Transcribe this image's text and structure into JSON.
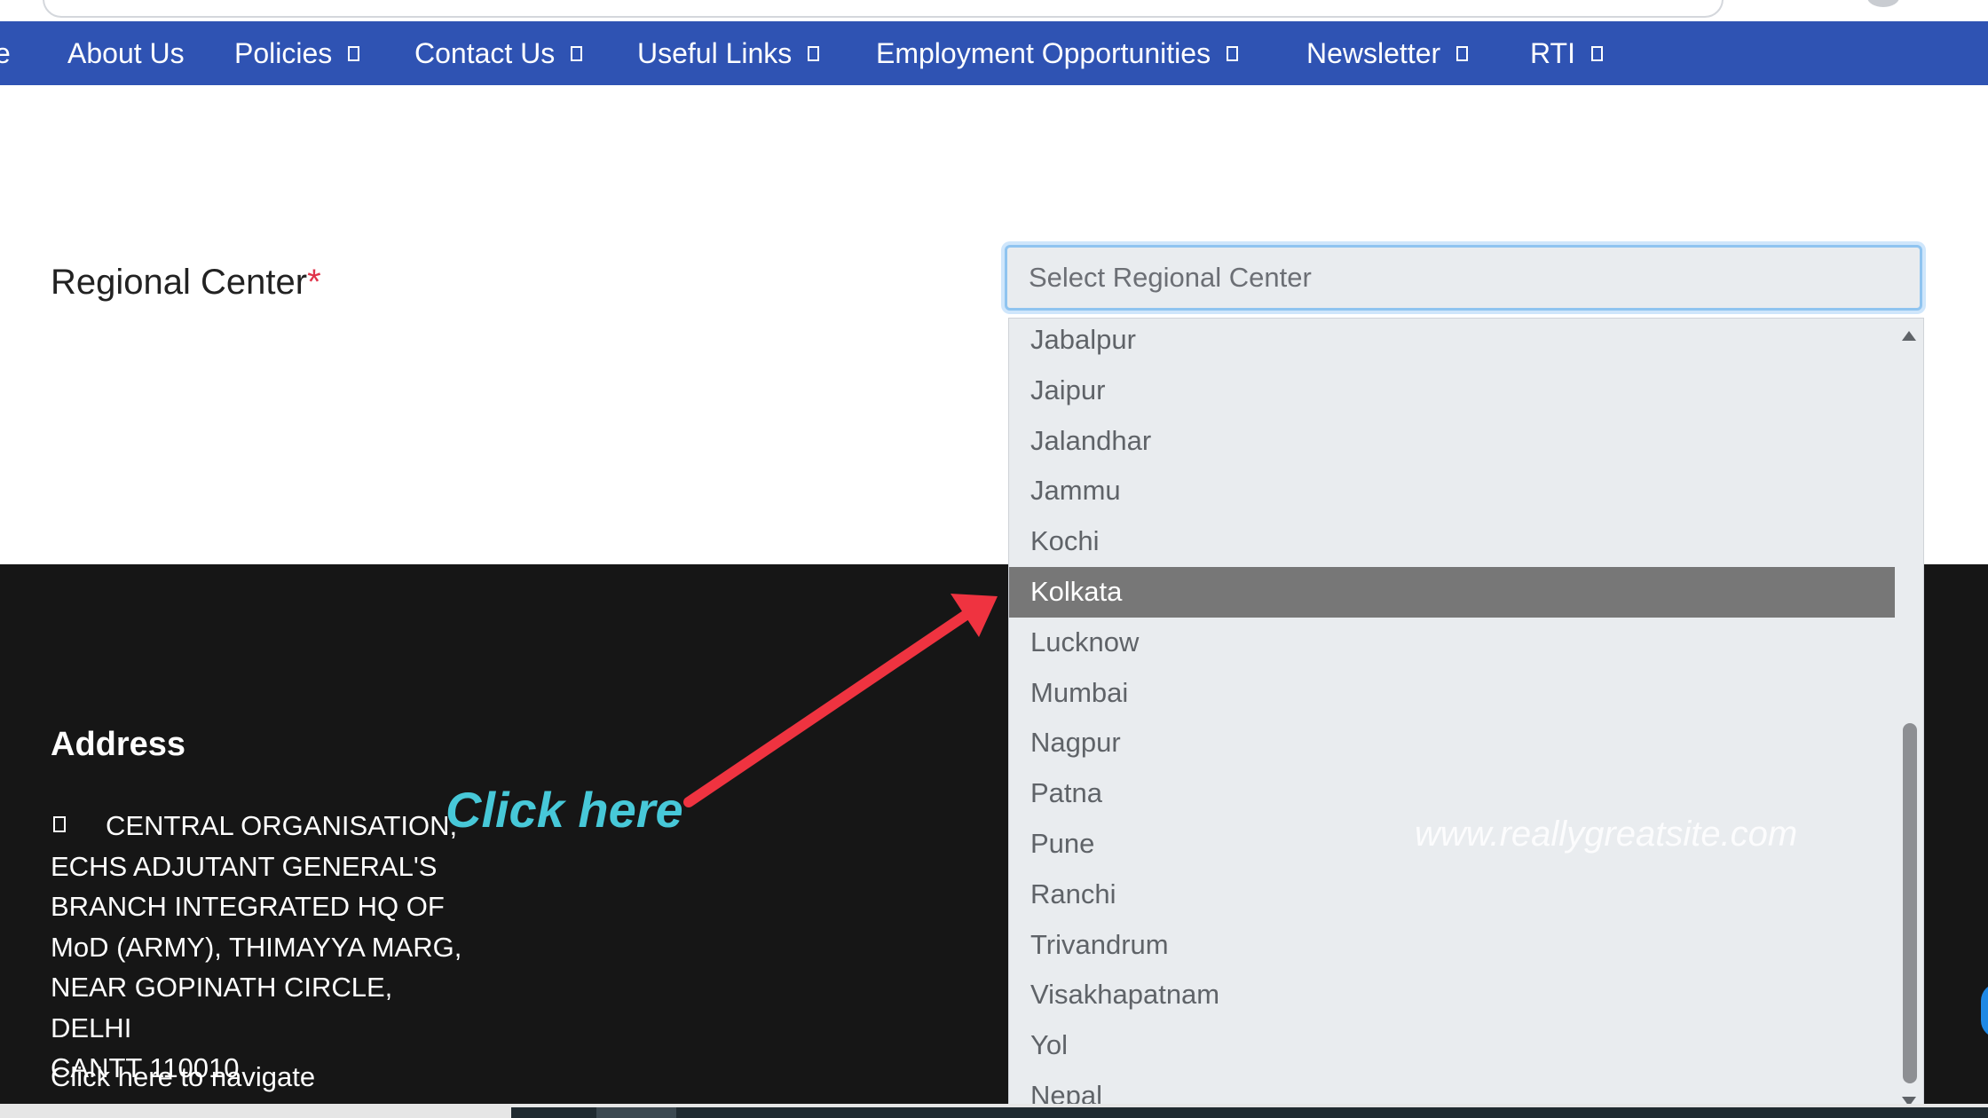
{
  "nav": {
    "items": [
      {
        "label": "e",
        "dropdown": false
      },
      {
        "label": "About Us",
        "dropdown": false
      },
      {
        "label": "Policies",
        "dropdown": true
      },
      {
        "label": "Contact Us",
        "dropdown": true
      },
      {
        "label": "Useful Links",
        "dropdown": true
      },
      {
        "label": "Employment Opportunities",
        "dropdown": true
      },
      {
        "label": "Newsletter",
        "dropdown": true
      },
      {
        "label": "RTI",
        "dropdown": true
      }
    ]
  },
  "form": {
    "label": "Regional Center",
    "required_mark": "*",
    "select_placeholder": "Select Regional Center"
  },
  "dropdown": {
    "options": [
      "Jabalpur",
      "Jaipur",
      "Jalandhar",
      "Jammu",
      "Kochi",
      "Kolkata",
      "Lucknow",
      "Mumbai",
      "Nagpur",
      "Patna",
      "Pune",
      "Ranchi",
      "Trivandrum",
      "Visakhapatnam",
      "Yol",
      "Nepal"
    ],
    "selected": "Kolkata"
  },
  "footer": {
    "title": "Address",
    "address": "CENTRAL ORGANISATION,\nECHS ADJUTANT GENERAL'S\nBRANCH INTEGRATED HQ OF\nMoD (ARMY), THIMAYYA MARG,\nNEAR GOPINATH CIRCLE, DELHI\nCANTT 110010",
    "navigate_link": "Click here to navigate"
  },
  "annotation": {
    "text": "Click here",
    "arrow_color": "#ef3340"
  },
  "watermark": "www.reallygreatsite.com",
  "colors": {
    "nav_bg": "#2f53b3",
    "footer_bg": "#161616",
    "selected_bg": "#777777",
    "annotation_text": "#47c8d8"
  }
}
